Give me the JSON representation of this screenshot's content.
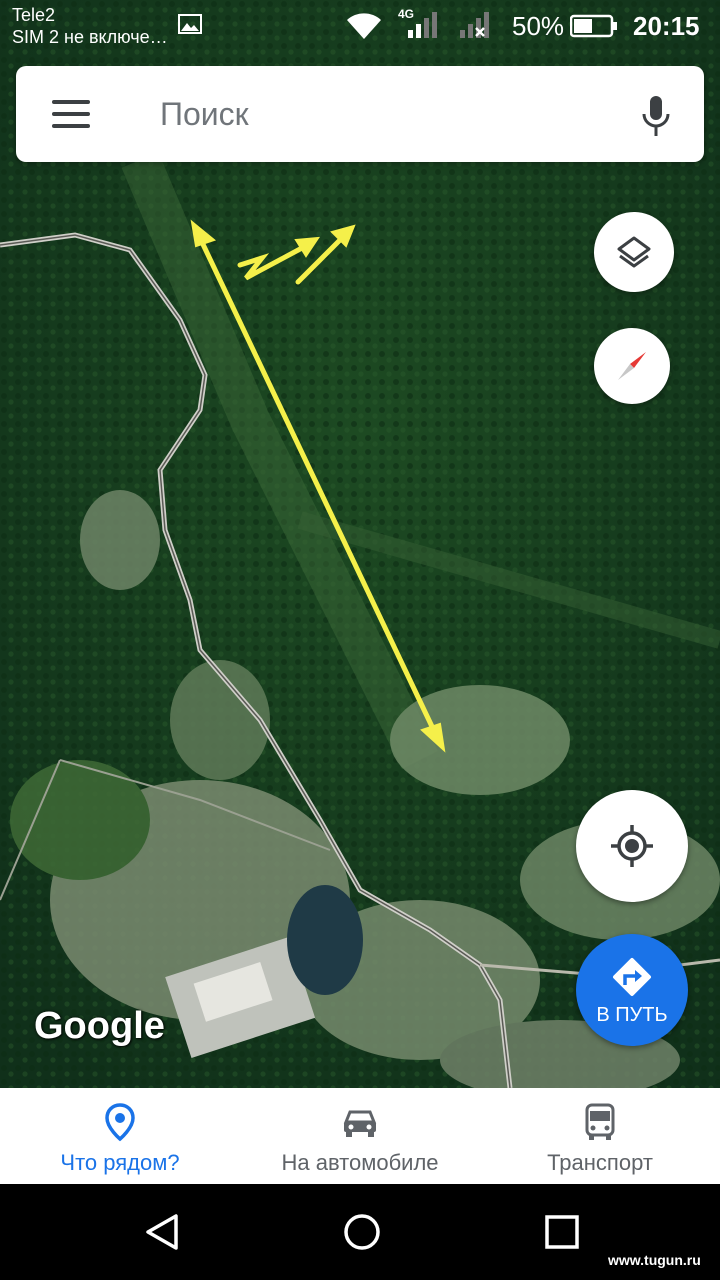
{
  "status_bar": {
    "carrier": "Tele2",
    "sim2_status": "SIM 2 не включе…",
    "network_type": "4G",
    "battery_percent": "50%",
    "battery_level": 0.5,
    "time": "20:15"
  },
  "search": {
    "placeholder": "Поиск"
  },
  "map": {
    "attribution": "Google",
    "type": "satellite"
  },
  "actions": {
    "go_label": "В ПУТЬ"
  },
  "bottom_nav": {
    "items": [
      {
        "label": "Что рядом?",
        "icon": "explore-pin-icon",
        "active": true
      },
      {
        "label": "На автомобиле",
        "icon": "car-icon",
        "active": false
      },
      {
        "label": "Транспорт",
        "icon": "bus-icon",
        "active": false
      }
    ]
  },
  "watermark": "www.tugun.ru",
  "colors": {
    "accent": "#1a73e8",
    "annotation_arrow": "#f5f04a",
    "forest_dark": "#143a18"
  }
}
